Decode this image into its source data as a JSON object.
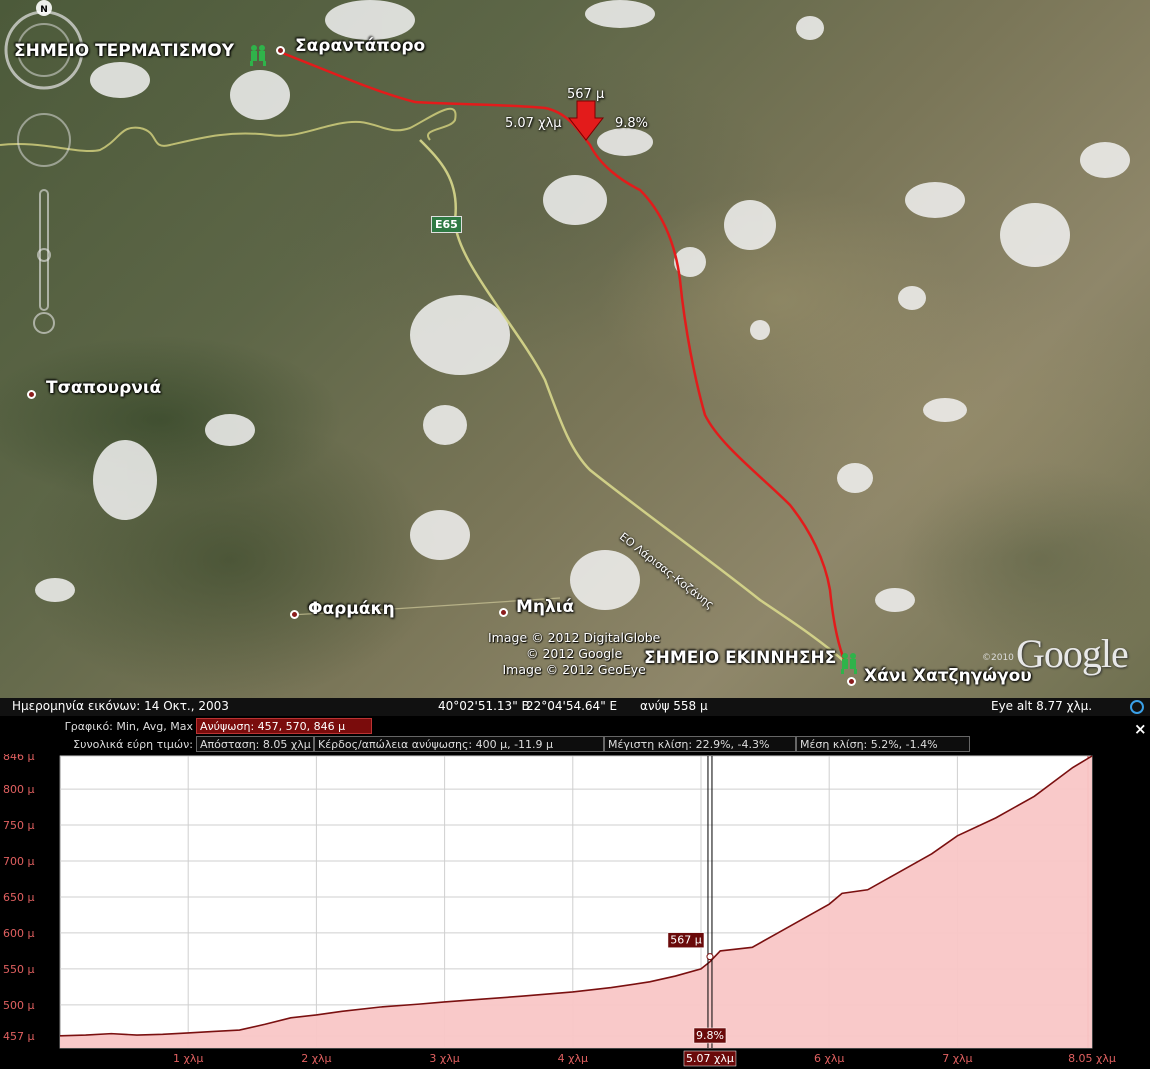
{
  "map": {
    "places": {
      "finish_label": "ΣΗΜΕΙΟ ΤΕΡΜΑΤΙΣΜΟΥ",
      "sarantaporo": "Σαραντάπορο",
      "tsapournia": "Τσαπουρνιά",
      "farmaki": "Φαρμάκη",
      "milia": "Μηλιά",
      "start_label": "ΣΗΜΕΙΟ ΕΚΙΝΝΗΣΗΣ",
      "hani": "Χάνι Χατζηγώγου"
    },
    "road_shield": "E65",
    "road_name": "ΕΟ Λάρισας-Κοζάνης",
    "marker": {
      "elevation": "567 μ",
      "distance": "5.07 χλμ",
      "slope": "9.8%"
    },
    "credits": [
      "Image © 2012 DigitalGlobe",
      "© 2012 Google",
      "Image © 2012 GeoEye"
    ],
    "google_logo": "Google",
    "google_year": "©2010",
    "compass_north": "N"
  },
  "status_bar": {
    "imagery_date": "Ημερομηνία εικόνων: 14 Οκτ., 2003",
    "lat": "40°02'51.13\" Β",
    "lon": "22°04'54.64\" Ε",
    "elevation": "ανύψ  558 μ",
    "eye_alt": "Eye alt   8.77 χλμ."
  },
  "elevation_panel": {
    "row1_label": "Γραφικό: Min, Avg, Max",
    "row1_value": "Ανύψωση: 457, 570, 846 μ",
    "row2_label": "Συνολικά εύρη τιμών:",
    "distance": "Απόσταση: 8.05 χλμ",
    "gain_loss": "Κέρδος/απώλεια ανύψωσης: 400 μ, -11.9 μ",
    "max_slope": "Μέγιστη κλίση: 22.9%, -4.3%",
    "avg_slope": "Μέση κλίση: 5.2%, -1.4%",
    "close_glyph": "×"
  },
  "chart_data": {
    "type": "area",
    "xlabel": "",
    "ylabel": "",
    "x_unit": "χλμ",
    "y_unit": "μ",
    "xlim": [
      0,
      8.05
    ],
    "ylim": [
      440,
      846
    ],
    "y_ticks": [
      457,
      500,
      550,
      600,
      650,
      700,
      750,
      800,
      846
    ],
    "x_ticks": [
      1,
      2,
      3,
      4,
      5,
      6,
      7
    ],
    "x_tick_labels": [
      "1 χλμ",
      "2 χλμ",
      "3 χλμ",
      "4 χλμ",
      "5 χλμ",
      "6 χλμ",
      "7 χλμ"
    ],
    "end_label": "8.05 χλμ",
    "cursor": {
      "x": 5.07,
      "x_label": "5.07 χλμ",
      "y": 567,
      "y_label": "567 μ",
      "slope_label": "9.8%"
    },
    "grid": true,
    "colors": {
      "fill": "#f9c6c6",
      "line": "#7a1010",
      "grid": "#cfcfcf",
      "accent": "#6a0a0a"
    },
    "x": [
      0,
      0.2,
      0.4,
      0.6,
      0.8,
      1.0,
      1.2,
      1.4,
      1.6,
      1.8,
      2.0,
      2.2,
      2.5,
      2.8,
      3.0,
      3.3,
      3.6,
      4.0,
      4.3,
      4.6,
      4.8,
      5.0,
      5.07,
      5.15,
      5.4,
      5.6,
      5.8,
      6.0,
      6.1,
      6.3,
      6.5,
      6.8,
      7.0,
      7.3,
      7.6,
      7.9,
      8.05
    ],
    "y": [
      457,
      458,
      460,
      458,
      459,
      461,
      463,
      465,
      473,
      482,
      486,
      491,
      497,
      501,
      504,
      508,
      512,
      518,
      524,
      532,
      540,
      550,
      560,
      575,
      580,
      600,
      620,
      640,
      655,
      660,
      680,
      710,
      735,
      760,
      790,
      830,
      846
    ]
  }
}
